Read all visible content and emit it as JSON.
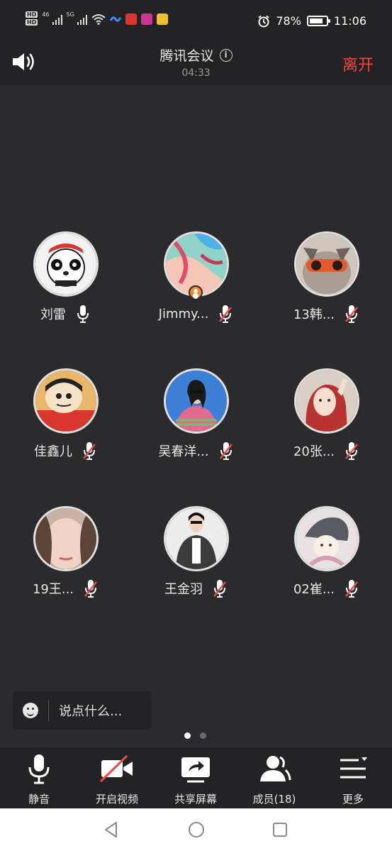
{
  "status_bar": {
    "network_1": "46",
    "network_2": "5G",
    "battery": "78%",
    "time": "11:06"
  },
  "header": {
    "title": "腾讯会议",
    "timer": "04:33",
    "leave_label": "离开"
  },
  "participants": [
    {
      "name": "刘雷",
      "muted": false,
      "host": false
    },
    {
      "name": "Jimmy...",
      "muted": true,
      "host": true
    },
    {
      "name": "13韩...",
      "muted": true,
      "host": false
    },
    {
      "name": "佳鑫儿",
      "muted": true,
      "host": false
    },
    {
      "name": "吴春洋...",
      "muted": true,
      "host": false
    },
    {
      "name": "20张...",
      "muted": true,
      "host": false
    },
    {
      "name": "19王...",
      "muted": true,
      "host": false
    },
    {
      "name": "王金羽",
      "muted": true,
      "host": false
    },
    {
      "name": "02崔...",
      "muted": true,
      "host": false
    }
  ],
  "chat": {
    "placeholder": "说点什么..."
  },
  "toolbar": {
    "mute_label": "静音",
    "video_label": "开启视频",
    "share_label": "共享屏幕",
    "members_label": "成员(18)",
    "more_label": "更多"
  },
  "colors": {
    "accent_red": "#ee4a44",
    "background": "#2b2b2e",
    "bar": "#232325",
    "host_badge": "#f08a2c"
  }
}
